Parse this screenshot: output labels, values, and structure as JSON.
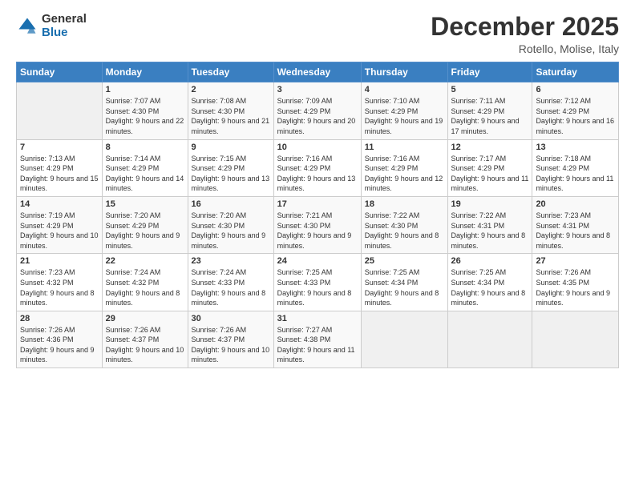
{
  "logo": {
    "general": "General",
    "blue": "Blue"
  },
  "title": "December 2025",
  "location": "Rotello, Molise, Italy",
  "days_of_week": [
    "Sunday",
    "Monday",
    "Tuesday",
    "Wednesday",
    "Thursday",
    "Friday",
    "Saturday"
  ],
  "weeks": [
    [
      {
        "day": "",
        "sunrise": "",
        "sunset": "",
        "daylight": ""
      },
      {
        "day": "1",
        "sunrise": "Sunrise: 7:07 AM",
        "sunset": "Sunset: 4:30 PM",
        "daylight": "Daylight: 9 hours and 22 minutes."
      },
      {
        "day": "2",
        "sunrise": "Sunrise: 7:08 AM",
        "sunset": "Sunset: 4:30 PM",
        "daylight": "Daylight: 9 hours and 21 minutes."
      },
      {
        "day": "3",
        "sunrise": "Sunrise: 7:09 AM",
        "sunset": "Sunset: 4:29 PM",
        "daylight": "Daylight: 9 hours and 20 minutes."
      },
      {
        "day": "4",
        "sunrise": "Sunrise: 7:10 AM",
        "sunset": "Sunset: 4:29 PM",
        "daylight": "Daylight: 9 hours and 19 minutes."
      },
      {
        "day": "5",
        "sunrise": "Sunrise: 7:11 AM",
        "sunset": "Sunset: 4:29 PM",
        "daylight": "Daylight: 9 hours and 17 minutes."
      },
      {
        "day": "6",
        "sunrise": "Sunrise: 7:12 AM",
        "sunset": "Sunset: 4:29 PM",
        "daylight": "Daylight: 9 hours and 16 minutes."
      }
    ],
    [
      {
        "day": "7",
        "sunrise": "Sunrise: 7:13 AM",
        "sunset": "Sunset: 4:29 PM",
        "daylight": "Daylight: 9 hours and 15 minutes."
      },
      {
        "day": "8",
        "sunrise": "Sunrise: 7:14 AM",
        "sunset": "Sunset: 4:29 PM",
        "daylight": "Daylight: 9 hours and 14 minutes."
      },
      {
        "day": "9",
        "sunrise": "Sunrise: 7:15 AM",
        "sunset": "Sunset: 4:29 PM",
        "daylight": "Daylight: 9 hours and 13 minutes."
      },
      {
        "day": "10",
        "sunrise": "Sunrise: 7:16 AM",
        "sunset": "Sunset: 4:29 PM",
        "daylight": "Daylight: 9 hours and 13 minutes."
      },
      {
        "day": "11",
        "sunrise": "Sunrise: 7:16 AM",
        "sunset": "Sunset: 4:29 PM",
        "daylight": "Daylight: 9 hours and 12 minutes."
      },
      {
        "day": "12",
        "sunrise": "Sunrise: 7:17 AM",
        "sunset": "Sunset: 4:29 PM",
        "daylight": "Daylight: 9 hours and 11 minutes."
      },
      {
        "day": "13",
        "sunrise": "Sunrise: 7:18 AM",
        "sunset": "Sunset: 4:29 PM",
        "daylight": "Daylight: 9 hours and 11 minutes."
      }
    ],
    [
      {
        "day": "14",
        "sunrise": "Sunrise: 7:19 AM",
        "sunset": "Sunset: 4:29 PM",
        "daylight": "Daylight: 9 hours and 10 minutes."
      },
      {
        "day": "15",
        "sunrise": "Sunrise: 7:20 AM",
        "sunset": "Sunset: 4:29 PM",
        "daylight": "Daylight: 9 hours and 9 minutes."
      },
      {
        "day": "16",
        "sunrise": "Sunrise: 7:20 AM",
        "sunset": "Sunset: 4:30 PM",
        "daylight": "Daylight: 9 hours and 9 minutes."
      },
      {
        "day": "17",
        "sunrise": "Sunrise: 7:21 AM",
        "sunset": "Sunset: 4:30 PM",
        "daylight": "Daylight: 9 hours and 9 minutes."
      },
      {
        "day": "18",
        "sunrise": "Sunrise: 7:22 AM",
        "sunset": "Sunset: 4:30 PM",
        "daylight": "Daylight: 9 hours and 8 minutes."
      },
      {
        "day": "19",
        "sunrise": "Sunrise: 7:22 AM",
        "sunset": "Sunset: 4:31 PM",
        "daylight": "Daylight: 9 hours and 8 minutes."
      },
      {
        "day": "20",
        "sunrise": "Sunrise: 7:23 AM",
        "sunset": "Sunset: 4:31 PM",
        "daylight": "Daylight: 9 hours and 8 minutes."
      }
    ],
    [
      {
        "day": "21",
        "sunrise": "Sunrise: 7:23 AM",
        "sunset": "Sunset: 4:32 PM",
        "daylight": "Daylight: 9 hours and 8 minutes."
      },
      {
        "day": "22",
        "sunrise": "Sunrise: 7:24 AM",
        "sunset": "Sunset: 4:32 PM",
        "daylight": "Daylight: 9 hours and 8 minutes."
      },
      {
        "day": "23",
        "sunrise": "Sunrise: 7:24 AM",
        "sunset": "Sunset: 4:33 PM",
        "daylight": "Daylight: 9 hours and 8 minutes."
      },
      {
        "day": "24",
        "sunrise": "Sunrise: 7:25 AM",
        "sunset": "Sunset: 4:33 PM",
        "daylight": "Daylight: 9 hours and 8 minutes."
      },
      {
        "day": "25",
        "sunrise": "Sunrise: 7:25 AM",
        "sunset": "Sunset: 4:34 PM",
        "daylight": "Daylight: 9 hours and 8 minutes."
      },
      {
        "day": "26",
        "sunrise": "Sunrise: 7:25 AM",
        "sunset": "Sunset: 4:34 PM",
        "daylight": "Daylight: 9 hours and 8 minutes."
      },
      {
        "day": "27",
        "sunrise": "Sunrise: 7:26 AM",
        "sunset": "Sunset: 4:35 PM",
        "daylight": "Daylight: 9 hours and 9 minutes."
      }
    ],
    [
      {
        "day": "28",
        "sunrise": "Sunrise: 7:26 AM",
        "sunset": "Sunset: 4:36 PM",
        "daylight": "Daylight: 9 hours and 9 minutes."
      },
      {
        "day": "29",
        "sunrise": "Sunrise: 7:26 AM",
        "sunset": "Sunset: 4:37 PM",
        "daylight": "Daylight: 9 hours and 10 minutes."
      },
      {
        "day": "30",
        "sunrise": "Sunrise: 7:26 AM",
        "sunset": "Sunset: 4:37 PM",
        "daylight": "Daylight: 9 hours and 10 minutes."
      },
      {
        "day": "31",
        "sunrise": "Sunrise: 7:27 AM",
        "sunset": "Sunset: 4:38 PM",
        "daylight": "Daylight: 9 hours and 11 minutes."
      },
      {
        "day": "",
        "sunrise": "",
        "sunset": "",
        "daylight": ""
      },
      {
        "day": "",
        "sunrise": "",
        "sunset": "",
        "daylight": ""
      },
      {
        "day": "",
        "sunrise": "",
        "sunset": "",
        "daylight": ""
      }
    ]
  ]
}
